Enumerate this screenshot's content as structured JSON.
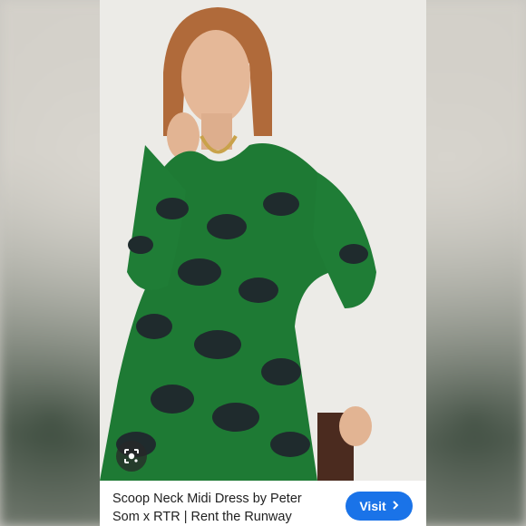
{
  "product": {
    "title": "Scoop Neck Midi Dress by Peter Som x RTR | Rent the Runway"
  },
  "actions": {
    "visit_label": "Visit",
    "lens_icon": "google-lens-icon",
    "chevron_icon": "chevron-right-icon"
  },
  "colors": {
    "accent": "#1a73e8",
    "dress_green": "#1e7a34",
    "print_dark": "#1f2b2d"
  }
}
